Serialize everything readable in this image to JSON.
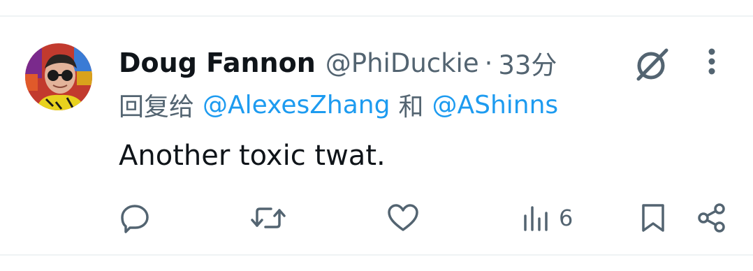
{
  "tweet": {
    "author": {
      "display_name": "Doug Fannon",
      "handle": "@PhiDuckie"
    },
    "separator": "·",
    "timestamp": "33分",
    "reply_to": {
      "prefix": "回复给",
      "mention_1": "@AlexesZhang",
      "conjunction": "和",
      "mention_2": "@AShinns"
    },
    "text": "Another toxic twat.",
    "stats": {
      "views": "6"
    }
  },
  "icons": {
    "grok": "grok-icon",
    "more": "more-vertical-icon",
    "reply": "reply-icon",
    "retweet": "retweet-icon",
    "like": "heart-icon",
    "views": "bar-chart-icon",
    "bookmark": "bookmark-icon",
    "share": "share-icon"
  },
  "colors": {
    "text": "#0f1419",
    "secondary": "#536471",
    "link": "#1d9bf0",
    "divider": "#eff3f4"
  }
}
